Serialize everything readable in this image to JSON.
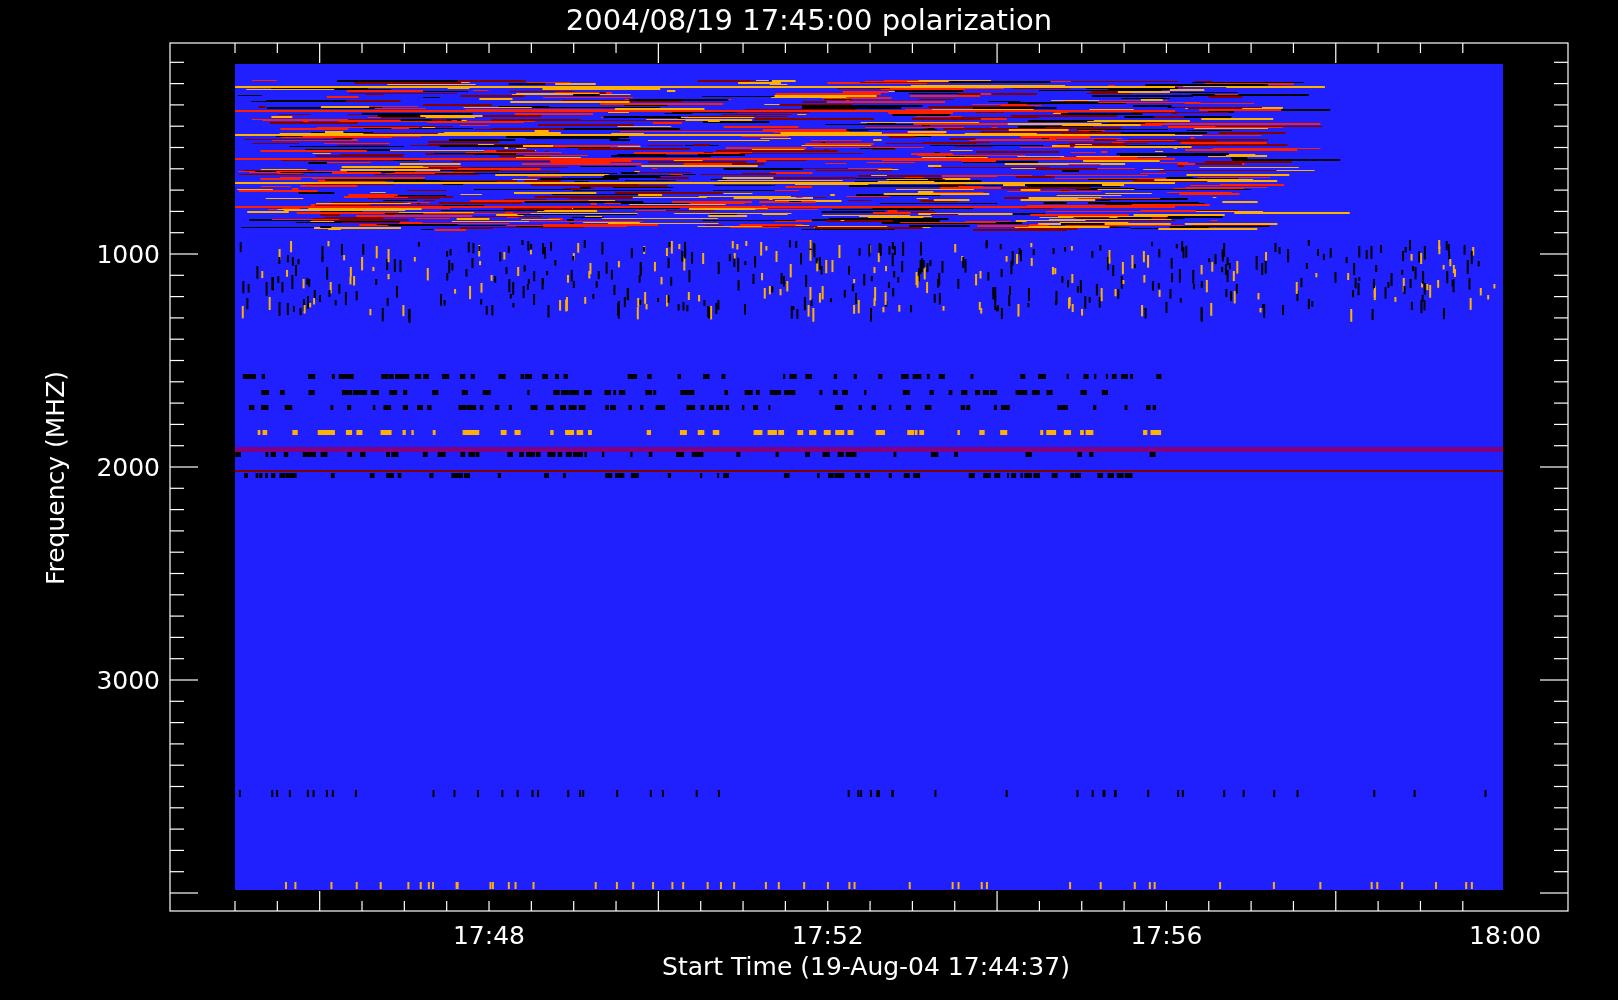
{
  "title": "2004/08/19 17:45:00 polarization",
  "x_axis": {
    "label": "Start Time (19-Aug-04 17:44:37)",
    "ticks": [
      "17:48",
      "17:52",
      "17:56",
      "18:00"
    ]
  },
  "y_axis": {
    "label": "Frequency (MHZ)",
    "ticks": [
      "1000",
      "2000",
      "3000"
    ]
  }
}
